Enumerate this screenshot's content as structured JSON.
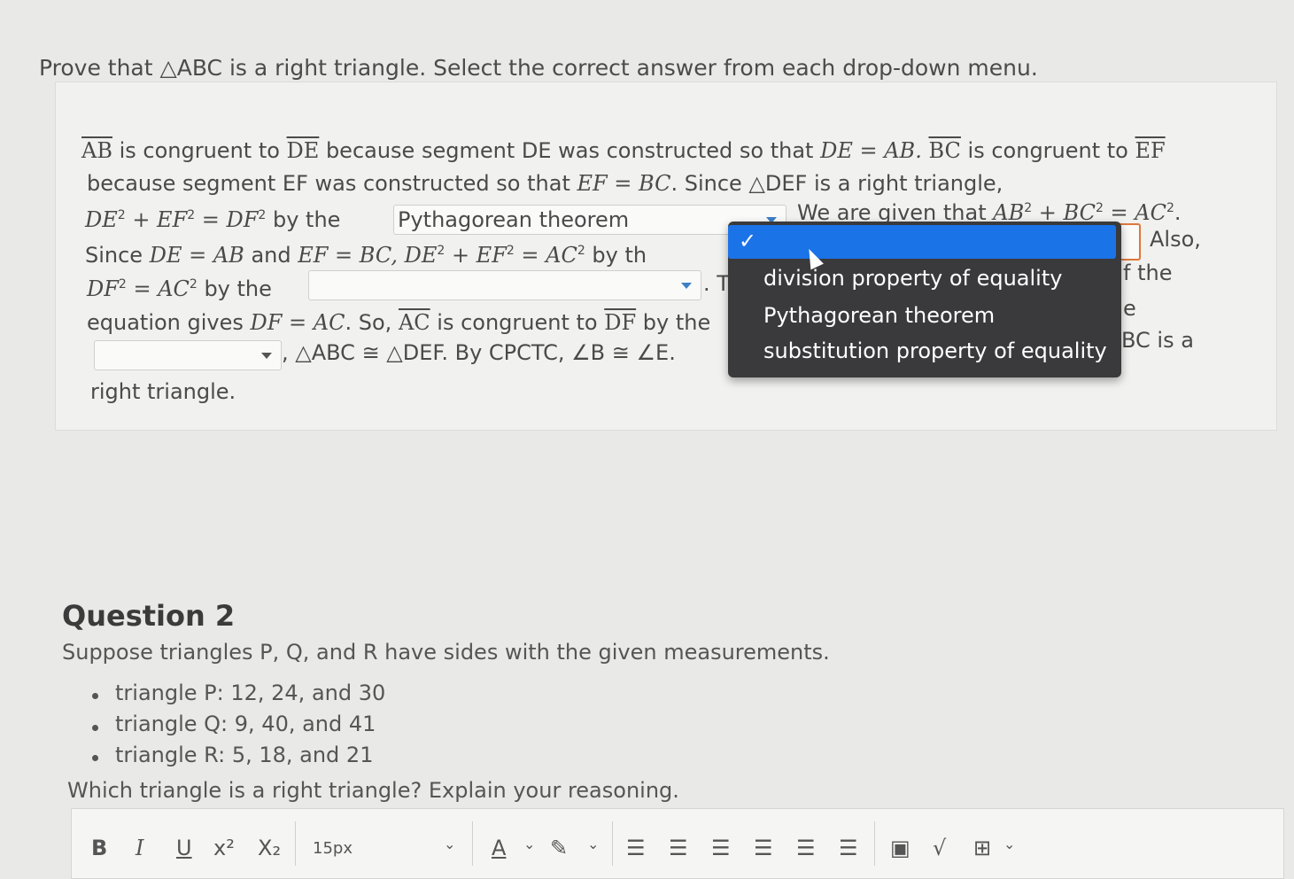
{
  "prompt": "Prove that △ABC is a right triangle. Select the correct answer from each drop-down menu.",
  "proof": {
    "l1_seg1": "AB",
    "l1_a": " is congruent to ",
    "l1_seg2": "DE",
    "l1_b": " because segment DE was constructed so that ",
    "l1_eq": "DE = AB.",
    "l1_seg3": "BC",
    "l1_c": " is congruent to ",
    "l1_seg4": "EF",
    "l2": "because segment EF was constructed so that ",
    "l2_eq": "EF = BC",
    "l2_b": ". Since △DEF is a right triangle,",
    "l3_eq_a": "DE",
    "l3_eq_b": " + EF",
    "l3_eq_c": " = DF",
    "l3_b": " by the",
    "select1_value": "Pythagorean theorem",
    "l3_c": "We are given that ",
    "l3_eq2_a": "AB",
    "l3_eq2_b": " + BC",
    "l3_eq2_c": " = AC",
    "l4_a": "Since ",
    "l4_eq1": "DE = AB",
    "l4_b": " and ",
    "l4_eq2": "EF = BC, DE",
    "l4_eq3": " + EF",
    "l4_eq4": " = AC",
    "l4_c": " by th",
    "l4_d": "Also,",
    "l5_eq_a": "DF",
    "l5_eq_b": " = AC",
    "l5_b": " by the",
    "select3_value": "",
    "l5_c": ". T",
    "l5_d": "f the",
    "l6_a": "equation gives ",
    "l6_eq": "DF = AC",
    "l6_b": ". So, ",
    "l6_seg1": "AC",
    "l6_c": " is congruent to ",
    "l6_seg2": "DF",
    "l6_d": " by the",
    "l6_e": "e",
    "select4_value": "",
    "l7_a": ", △ABC ≅ △DEF. By CPCTC, ∠B ≅ ∠E.",
    "l7_b": "BC is a",
    "l8": "right triangle.",
    "sup": "2"
  },
  "dropdown": {
    "check": "✓",
    "options": [
      "division property of equality",
      "Pythagorean theorem",
      "substitution property of equality"
    ]
  },
  "question2": {
    "title": "Question 2",
    "intro": "Suppose triangles P, Q, and R have sides with the given measurements.",
    "items": [
      "triangle P: 12, 24, and 30",
      "triangle Q: 9, 40, and 41",
      "triangle R: 5, 18, and 21"
    ],
    "ask": "Which triangle is a right triangle? Explain your reasoning."
  },
  "toolbar": {
    "bold": "B",
    "italic": "I",
    "underline": "U",
    "superscript": "x²",
    "subscript": "X₂",
    "font_size": "15px",
    "text_color": "A"
  }
}
